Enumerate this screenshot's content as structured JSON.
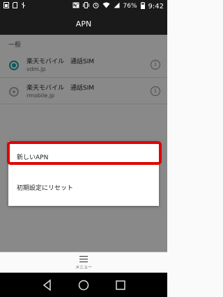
{
  "status_bar": {
    "battery_percent": "76%",
    "time": "9:42",
    "icons": [
      "notification-icon",
      "sd-card-icon",
      "usb-icon",
      "nfc-icon",
      "vibrate-icon",
      "alarm-icon",
      "wifi-icon",
      "signal-icon",
      "battery-icon"
    ]
  },
  "header": {
    "title": "APN"
  },
  "section": {
    "label": "一般"
  },
  "apn_list": [
    {
      "name": "楽天モバイル　通話SIM",
      "apn": "vdm.jp",
      "selected": true
    },
    {
      "name": "楽天モバイル　通話SIM",
      "apn": "rmobile.jp",
      "selected": false
    }
  ],
  "popup_menu": {
    "items": [
      "新しいAPN",
      "初期設定にリセット"
    ],
    "highlighted_index": 0,
    "highlight_color": "#e00000"
  },
  "bottom_bar": {
    "menu_label": "メニュー"
  },
  "colors": {
    "accent": "#16a2a0",
    "bar": "#1a1a1a"
  },
  "nav_bar": {
    "buttons": [
      "back-icon",
      "home-icon",
      "recents-icon"
    ]
  }
}
